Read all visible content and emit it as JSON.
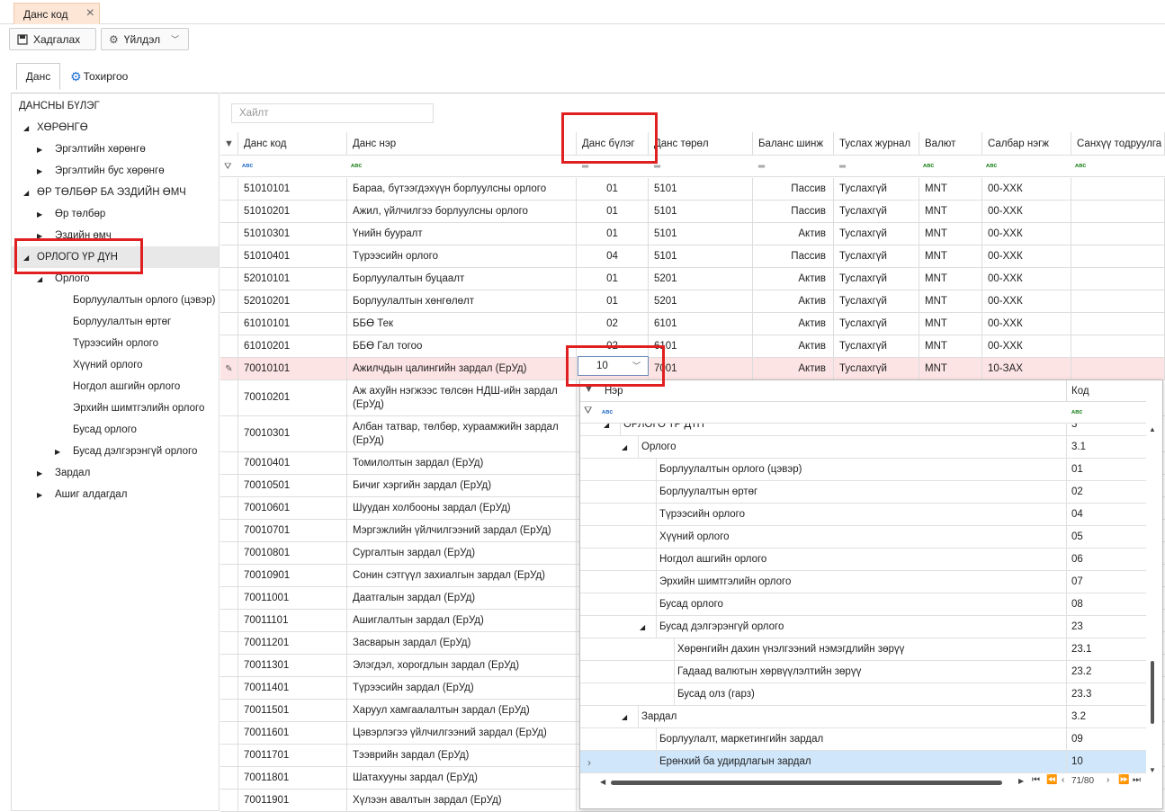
{
  "doc_tab": {
    "label": "Данс код"
  },
  "toolbar": {
    "save_label": "Хадгалах",
    "action_label": "Үйлдэл"
  },
  "tabs": [
    {
      "label": "Данс"
    },
    {
      "label": "Тохиргоо"
    }
  ],
  "tree": {
    "root": "ДАНСНЫ БҮЛЭГ",
    "items": [
      {
        "label": "ХӨРӨНГӨ"
      },
      {
        "label": "Эргэлтийн хөрөнгө"
      },
      {
        "label": "Эргэлтийн бус хөрөнгө"
      },
      {
        "label": "ӨР ТӨЛБӨР БА ЭЗДИЙН ӨМЧ"
      },
      {
        "label": "Өр төлбөр"
      },
      {
        "label": "Эздийн өмч"
      },
      {
        "label": "ОРЛОГО ҮР ДҮН"
      },
      {
        "label": "Орлого"
      },
      {
        "label": "Борлуулалтын орлого (цэвэр)"
      },
      {
        "label": "Борлуулалтын өртөг"
      },
      {
        "label": "Түрээсийн орлого"
      },
      {
        "label": "Хүүний орлого"
      },
      {
        "label": "Ногдол ашгийн орлого"
      },
      {
        "label": "Эрхийн шимтгэлийн орлого"
      },
      {
        "label": "Бусад орлого"
      },
      {
        "label": "Бусад дэлгэрэнгүй орлого"
      },
      {
        "label": "Зардал"
      },
      {
        "label": "Ашиг алдагдал"
      }
    ]
  },
  "search": {
    "placeholder": "Хайлт"
  },
  "columns": [
    "Данс код",
    "Данс нэр",
    "Данс бүлэг",
    "Данс төрөл",
    "Баланс шинж",
    "Туслах журнал",
    "Валют",
    "Салбар нэгж",
    "Санхүү тодруулга"
  ],
  "filter_icons": {
    "abc": "ABC",
    "eq": "="
  },
  "rows": [
    [
      "51010101",
      "Бараа, бүтээгдэхүүн борлуулсны орлого",
      "01",
      "5101",
      "Пассив",
      "Туслахгүй",
      "MNT",
      "00-ХХК"
    ],
    [
      "51010201",
      "Ажил, үйлчилгээ борлуулсны орлого",
      "01",
      "5101",
      "Пассив",
      "Туслахгүй",
      "MNT",
      "00-ХХК"
    ],
    [
      "51010301",
      "Үнийн бууралт",
      "01",
      "5101",
      "Актив",
      "Туслахгүй",
      "MNT",
      "00-ХХК"
    ],
    [
      "51010401",
      "Түрээсийн орлого",
      "04",
      "5101",
      "Пассив",
      "Туслахгүй",
      "MNT",
      "00-ХХК"
    ],
    [
      "52010101",
      "Борлуулалтын буцаалт",
      "01",
      "5201",
      "Актив",
      "Туслахгүй",
      "MNT",
      "00-ХХК"
    ],
    [
      "52010201",
      "Борлуулалтын хөнгөлөлт",
      "01",
      "5201",
      "Актив",
      "Туслахгүй",
      "MNT",
      "00-ХХК"
    ],
    [
      "61010101",
      "ББӨ Тек",
      "02",
      "6101",
      "Актив",
      "Туслахгүй",
      "MNT",
      "00-ХХК"
    ],
    [
      "61010201",
      "ББӨ Гал тогоо",
      "02",
      "6101",
      "Актив",
      "Туслахгүй",
      "MNT",
      "00-ХХК"
    ],
    [
      "70010101",
      "Ажилчдын цалингийн зардал (ЕрУд)",
      "10",
      "7001",
      "Актив",
      "Туслахгүй",
      "MNT",
      "10-ЗАХ"
    ],
    [
      "70010201",
      "Аж ахуйн нэгжээс төлсөн НДШ-ийн зардал (ЕрУд)",
      "",
      "",
      "",
      "",
      "",
      ""
    ],
    [
      "70010301",
      "Албан татвар, төлбөр, хураамжийн зардал (ЕрУд)",
      "",
      "",
      "",
      "",
      "",
      ""
    ],
    [
      "70010401",
      "Томилолтын зардал (ЕрУд)",
      "",
      "",
      "",
      "",
      "",
      ""
    ],
    [
      "70010501",
      "Бичиг хэргийн зардал (ЕрУд)",
      "",
      "",
      "",
      "",
      "",
      ""
    ],
    [
      "70010601",
      "Шуудан холбооны зардал (ЕрУд)",
      "",
      "",
      "",
      "",
      "",
      ""
    ],
    [
      "70010701",
      "Мэргэжлийн үйлчилгээний зардал (ЕрУд)",
      "",
      "",
      "",
      "",
      "",
      ""
    ],
    [
      "70010801",
      "Сургалтын зардал (ЕрУд)",
      "",
      "",
      "",
      "",
      "",
      ""
    ],
    [
      "70010901",
      "Сонин сэтгүүл захиалгын зардал (ЕрУд)",
      "",
      "",
      "",
      "",
      "",
      ""
    ],
    [
      "70011001",
      "Даатгалын зардал (ЕрУд)",
      "",
      "",
      "",
      "",
      "",
      ""
    ],
    [
      "70011101",
      "Ашиглалтын зардал (ЕрУд)",
      "",
      "",
      "",
      "",
      "",
      ""
    ],
    [
      "70011201",
      "Засварын зардал (ЕрУд)",
      "",
      "",
      "",
      "",
      "",
      ""
    ],
    [
      "70011301",
      "Элэгдэл, хорогдлын зардал (ЕрУд)",
      "",
      "",
      "",
      "",
      "",
      ""
    ],
    [
      "70011401",
      "Түрээсийн зардал (ЕрУд)",
      "",
      "",
      "",
      "",
      "",
      ""
    ],
    [
      "70011501",
      "Харуул хамгаалалтын зардал (ЕрУд)",
      "",
      "",
      "",
      "",
      "",
      ""
    ],
    [
      "70011601",
      "Цэвэрлэгээ үйлчилгээний зардал (ЕрУд)",
      "",
      "",
      "",
      "",
      "",
      ""
    ],
    [
      "70011701",
      "Тээврийн зардал (ЕрУд)",
      "",
      "",
      "",
      "",
      "",
      ""
    ],
    [
      "70011801",
      "Шатахууны зардал (ЕрУд)",
      "",
      "",
      "",
      "",
      "",
      ""
    ],
    [
      "70011901",
      "Хүлээн авалтын зардал (ЕрУд)",
      "",
      "",
      "",
      "",
      "",
      ""
    ]
  ],
  "editor": {
    "value": "10"
  },
  "popup": {
    "col_name": "Нэр",
    "col_code": "Код",
    "rows": [
      {
        "name": "ОРЛОГО ҮР ДҮН",
        "code": "3"
      },
      {
        "name": "Орлого",
        "code": "3.1"
      },
      {
        "name": "Борлуулалтын орлого (цэвэр)",
        "code": "01"
      },
      {
        "name": "Борлуулалтын өртөг",
        "code": "02"
      },
      {
        "name": "Түрээсийн орлого",
        "code": "04"
      },
      {
        "name": "Хүүний орлого",
        "code": "05"
      },
      {
        "name": "Ногдол ашгийн орлого",
        "code": "06"
      },
      {
        "name": "Эрхийн шимтгэлийн орлого",
        "code": "07"
      },
      {
        "name": "Бусад орлого",
        "code": "08"
      },
      {
        "name": "Бусад дэлгэрэнгүй орлого",
        "code": "23"
      },
      {
        "name": "Хөрөнгийн дахин үнэлгээний нэмэгдлийн зөрүү",
        "code": "23.1"
      },
      {
        "name": "Гадаад валютын хөрвүүлэлтийн зөрүү",
        "code": "23.2"
      },
      {
        "name": "Бусад  олз (гарз)",
        "code": "23.3"
      },
      {
        "name": "Зардал",
        "code": "3.2"
      },
      {
        "name": "Борлуулалт, маркетингийн зардал",
        "code": "09"
      },
      {
        "name": "Ерөнхий ба удирдлагын зардал",
        "code": "10"
      }
    ],
    "pager": "71/80"
  },
  "colors": {
    "selected_row": "#fde4e4",
    "popup_selected": "#cfe6fb",
    "highlight_box": "#e02020",
    "doc_tab": "#fde6d6"
  }
}
